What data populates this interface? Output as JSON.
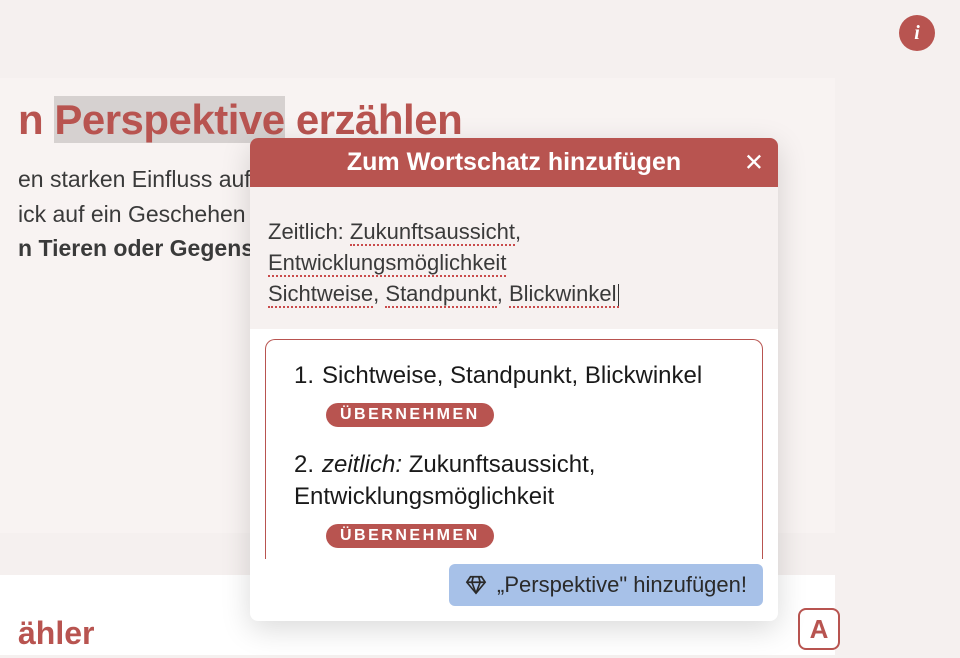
{
  "info_icon": "i",
  "background": {
    "title_part1": "n ",
    "title_highlight": "Perspektive",
    "title_part2": " erzählen",
    "line1": "en starken Einfluss auf",
    "line2": "ick auf ein Geschehen",
    "line3_bold": "n Tieren oder Gegenstä"
  },
  "bottom": {
    "title": "ähler"
  },
  "a_button": "A",
  "popup": {
    "header": "Zum Wortschatz hinzufügen",
    "input_line1_prefix": "Zeitlich: ",
    "input_line1_word1": "Zukunftsaussicht",
    "input_line1_sep": ", ",
    "input_line1_word2": "Entwicklungsmöglichkeit",
    "input_line2_word1": "Sichtweise",
    "input_line2_sep1": ", ",
    "input_line2_word2": "Standpunkt",
    "input_line2_sep2": ", ",
    "input_line2_word3": "Blickwinkel",
    "options": [
      {
        "num": "1.",
        "text": "Sichtweise, Standpunkt, Blickwinkel",
        "button": "ÜBERNEHMEN"
      },
      {
        "num": "2.",
        "label_italic": "zeitlich:",
        "text": " Zukunftsaussicht, Entwicklungsmöglichkeit",
        "button": "ÜBERNEHMEN"
      }
    ],
    "footer_button": "„Perspektive\" hinzufügen!"
  }
}
